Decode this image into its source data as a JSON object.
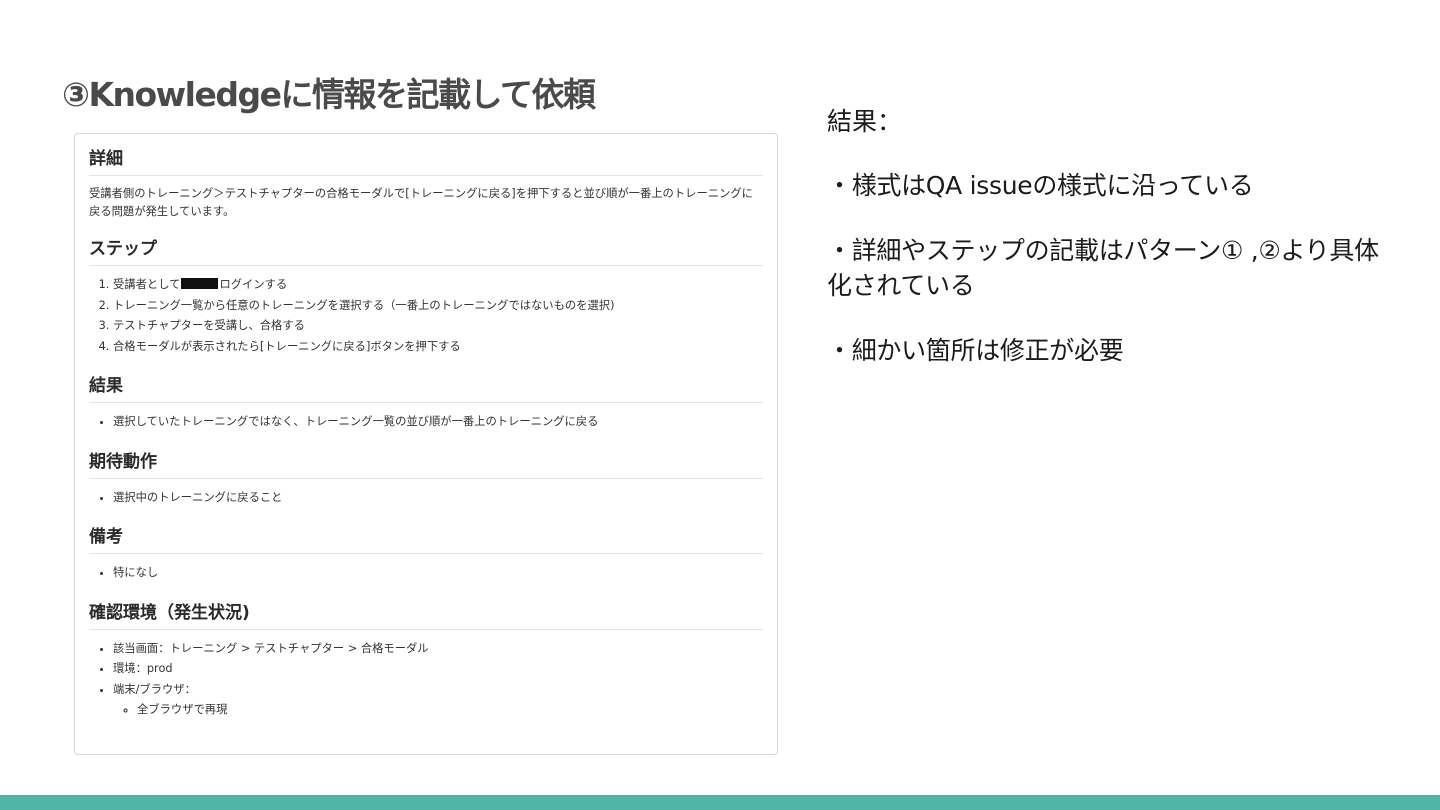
{
  "slide": {
    "title": "③Knowledgeに情報を記載して依頼"
  },
  "document": {
    "details": {
      "heading": "詳細",
      "text": "受講者側のトレーニング＞テストチャプターの合格モーダルで[トレーニングに戻る]を押下すると並び順が一番上のトレーニングに戻る問題が発生しています。"
    },
    "steps": {
      "heading": "ステップ",
      "items": [
        {
          "before": "受講者として",
          "after": "ログインする"
        },
        {
          "text": "トレーニング一覧から任意のトレーニングを選択する（一番上のトレーニングではないものを選択)"
        },
        {
          "text": "テストチャプターを受講し、合格する"
        },
        {
          "text": "合格モーダルが表示されたら[トレーニングに戻る]ボタンを押下する"
        }
      ]
    },
    "result": {
      "heading": "結果",
      "items": [
        "選択していたトレーニングではなく、トレーニング一覧の並び順が一番上のトレーニングに戻る"
      ]
    },
    "expected": {
      "heading": "期待動作",
      "items": [
        "選択中のトレーニングに戻ること"
      ]
    },
    "notes": {
      "heading": "備考",
      "items": [
        "特になし"
      ]
    },
    "environment": {
      "heading": "確認環境（発生状況)",
      "items": [
        "該当画面：トレーニング > テストチャプター > 合格モーダル",
        "環境：prod",
        "端末/ブラウザ："
      ],
      "subitems": [
        "全ブラウザで再現"
      ]
    }
  },
  "result_panel": {
    "label": "結果：",
    "points": [
      "・様式はQA issueの様式に沿っている",
      "・詳細やステップの記載はパターン① ,②より具体化されている",
      "・細かい箇所は修正が必要"
    ]
  },
  "colors": {
    "footer": "#51b5a6",
    "title": "#4a4a4a"
  }
}
